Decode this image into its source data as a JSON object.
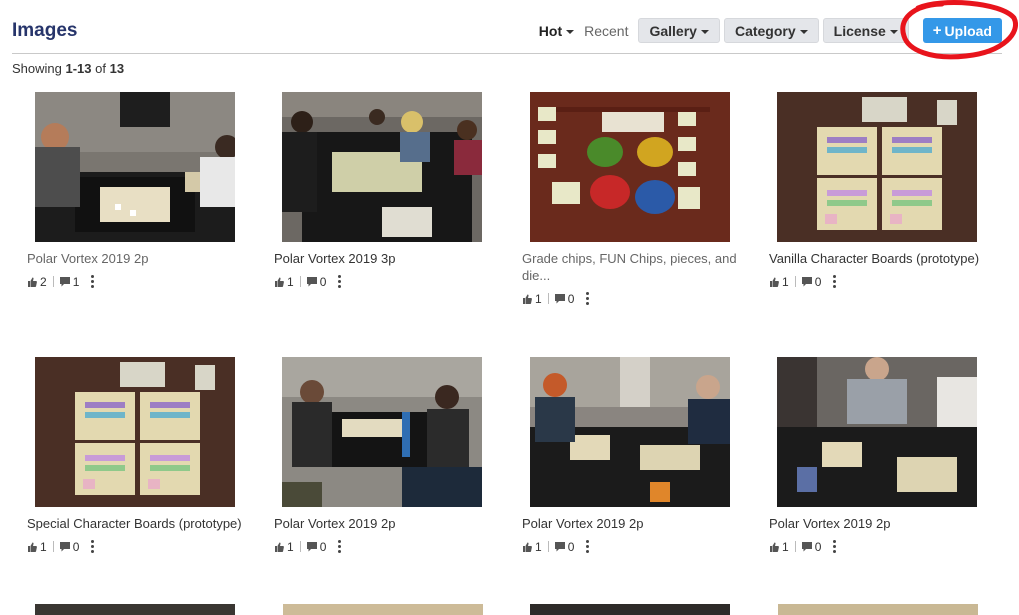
{
  "header": {
    "title": "Images",
    "sort_options": [
      {
        "label": "Hot",
        "active": true
      },
      {
        "label": "Recent",
        "active": false
      }
    ],
    "dropdowns": [
      "Gallery",
      "Category",
      "License"
    ],
    "upload_label": "Upload"
  },
  "showing": {
    "prefix": "Showing",
    "range": "1-13",
    "middle": "of",
    "total": "13"
  },
  "images": [
    {
      "title": "Polar Vortex 2019 2p",
      "likes": "2",
      "comments": "1",
      "thumb": "table-players"
    },
    {
      "title": "Polar Vortex 2019 3p",
      "likes": "1",
      "comments": "0",
      "thumb": "crowd-table"
    },
    {
      "title": "Grade chips, FUN Chips, pieces, and die...",
      "likes": "1",
      "comments": "0",
      "thumb": "chips"
    },
    {
      "title": "Vanilla Character Boards (prototype)",
      "likes": "1",
      "comments": "0",
      "thumb": "boards"
    },
    {
      "title": "Special Character Boards (prototype)",
      "likes": "1",
      "comments": "0",
      "thumb": "boards"
    },
    {
      "title": "Polar Vortex 2019 2p",
      "likes": "1",
      "comments": "0",
      "thumb": "two-players"
    },
    {
      "title": "Polar Vortex 2019 2p",
      "likes": "1",
      "comments": "0",
      "thumb": "two-players-b"
    },
    {
      "title": "Polar Vortex 2019 2p",
      "likes": "1",
      "comments": "0",
      "thumb": "single-player"
    }
  ],
  "colors": {
    "title": "#27356b",
    "upload": "#3498e8",
    "annotation": "#e8141c"
  }
}
